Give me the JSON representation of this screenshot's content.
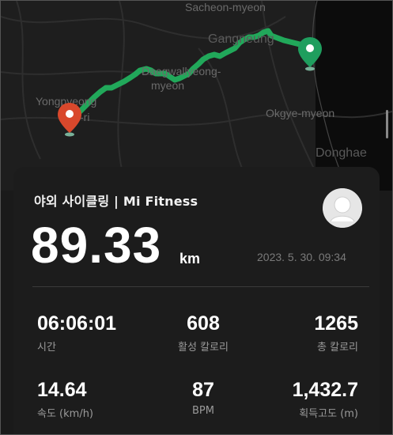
{
  "map": {
    "labels": {
      "sacheon": "Sacheon-myeon",
      "gangneung": "Gangneung",
      "daegwallyeong": "Daegwallyeong-",
      "daegwallyeong2": "myeon",
      "yongpyeong": "Yongpyeong",
      "yongpyeong2": "-ri",
      "okgye": "Okgye-myeon",
      "donghae": "Donghae"
    }
  },
  "activity": {
    "title": "야외 사이클링 | Mi Fitness",
    "distance": "89.33",
    "distance_unit": "km",
    "datetime": "2023. 5. 30. 09:34"
  },
  "stats": [
    {
      "value": "06:06:01",
      "label": "시간"
    },
    {
      "value": "608",
      "label": "활성 칼로리"
    },
    {
      "value": "1265",
      "label": "총 칼로리"
    },
    {
      "value": "14.64",
      "label": "속도 (km/h)"
    },
    {
      "value": "87",
      "label": "BPM"
    },
    {
      "value": "1,432.7",
      "label": "획득고도 (m)"
    }
  ],
  "colors": {
    "route": "#21a85a",
    "start_pin": "#1f9e5e",
    "end_pin": "#d9482c"
  }
}
